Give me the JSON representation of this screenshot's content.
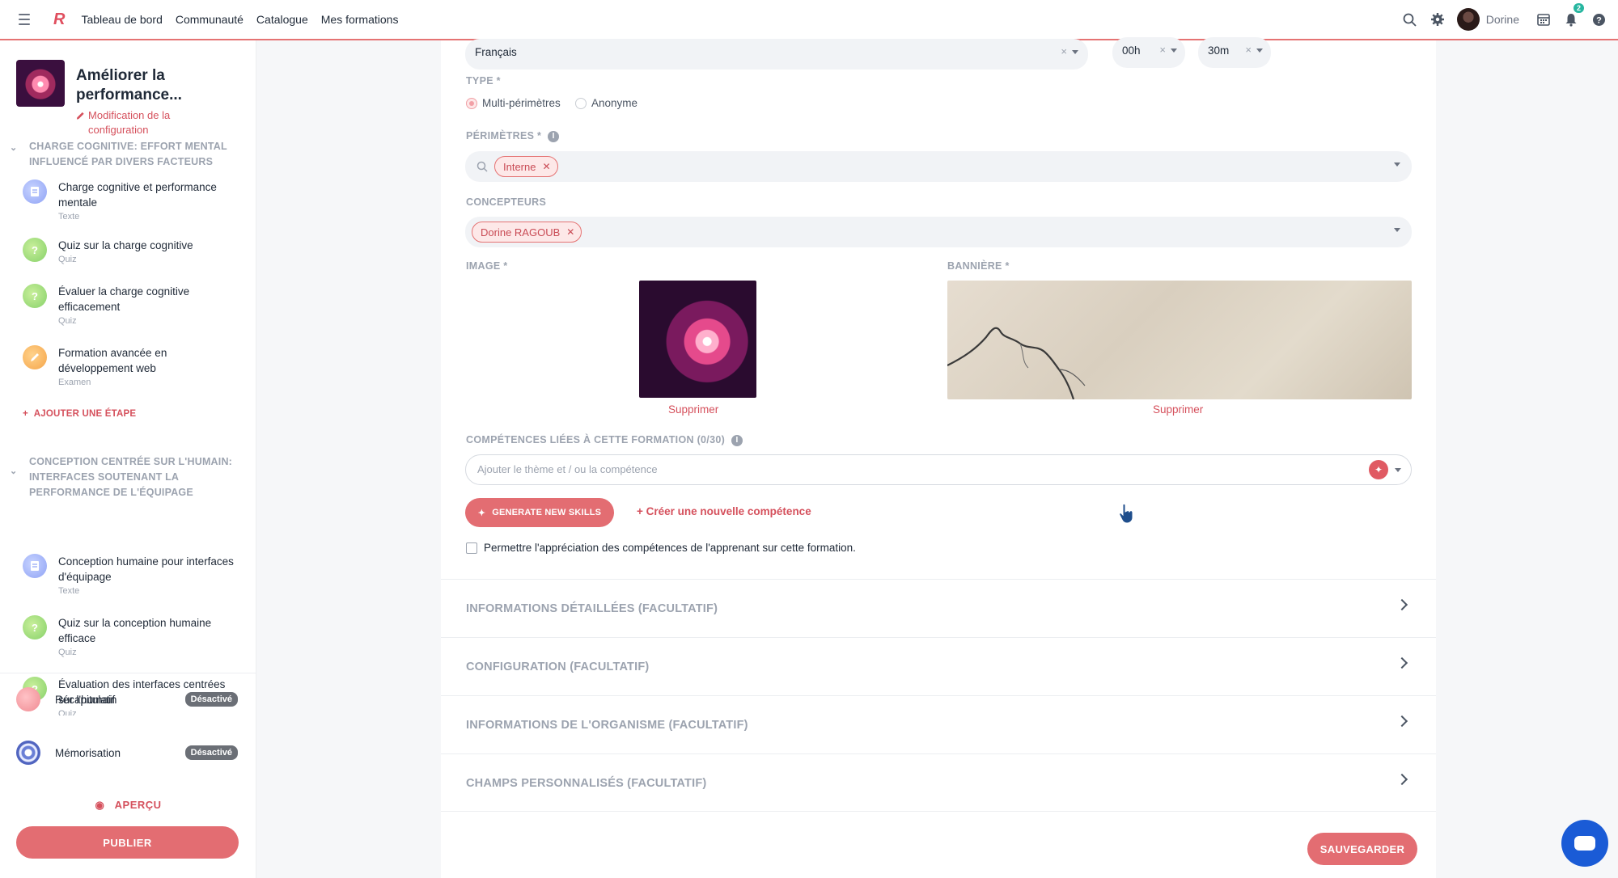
{
  "topbar": {
    "nav": [
      "Tableau de bord",
      "Communauté",
      "Catalogue",
      "Mes formations"
    ],
    "user": "Dorine",
    "notif_count": "2",
    "icons": [
      "menu-icon",
      "search-icon",
      "gear-icon",
      "calendar-icon",
      "bell-icon",
      "help-icon"
    ]
  },
  "sidebar": {
    "course_title": "Améliorer la performance...",
    "edit_label": "Modification de la configuration",
    "sections": [
      {
        "title": "CHARGE COGNITIVE: EFFORT MENTAL INFLUENCÉ PAR DIVERS FACTEURS",
        "steps": [
          {
            "title": "Charge cognitive et performance mentale",
            "type": "Texte"
          },
          {
            "title": "Quiz sur la charge cognitive",
            "type": "Quiz"
          },
          {
            "title": "Évaluer la charge cognitive efficacement",
            "type": "Quiz"
          },
          {
            "title": "Formation avancée en développement web",
            "type": "Examen"
          }
        ],
        "add_step": "AJOUTER UNE ÉTAPE"
      },
      {
        "title": "CONCEPTION CENTRÉE SUR L'HUMAIN: INTERFACES SOUTENANT LA PERFORMANCE DE L'ÉQUIPAGE",
        "steps": [
          {
            "title": "Conception humaine pour interfaces d'équipage",
            "type": "Texte"
          },
          {
            "title": "Quiz sur la conception humaine efficace",
            "type": "Quiz"
          },
          {
            "title": "Évaluation des interfaces centrées sur l'humain",
            "type": "Quiz"
          }
        ]
      }
    ],
    "features": [
      {
        "label": "Récapitulatif",
        "badge": "Désactivé"
      },
      {
        "label": "Mémorisation",
        "badge": "Désactivé"
      }
    ],
    "preview": "APERÇU",
    "publish": "PUBLIER"
  },
  "form": {
    "language": {
      "value": "Français"
    },
    "duration": {
      "hours": "00h",
      "minutes": "30m"
    },
    "type": {
      "label": "TYPE *",
      "options": [
        "Multi-périmètres",
        "Anonyme"
      ],
      "selected": "Multi-périmètres"
    },
    "perimeters": {
      "label": "PÉRIMÈTRES *",
      "chips": [
        "Interne"
      ]
    },
    "designers": {
      "label": "CONCEPTEURS",
      "chips": [
        "Dorine RAGOUB"
      ]
    },
    "image": {
      "label": "IMAGE *",
      "delete": "Supprimer"
    },
    "banner": {
      "label": "BANNIÈRE *",
      "delete": "Supprimer"
    },
    "skills": {
      "label": "COMPÉTENCES LIÉES À CETTE FORMATION (0/30)",
      "placeholder": "Ajouter le thème et / ou la compétence",
      "generate": "GENERATE NEW SKILLS",
      "create": "+ Créer une nouvelle compétence",
      "allow_rating": "Permettre l'appréciation des compétences de l'apprenant sur cette formation."
    },
    "accordions": [
      "INFORMATIONS DÉTAILLÉES (FACULTATIF)",
      "CONFIGURATION (FACULTATIF)",
      "INFORMATIONS DE L'ORGANISME (FACULTATIF)",
      "CHAMPS PERSONNALISÉS (FACULTATIF)"
    ],
    "save": "SAUVEGARDER"
  },
  "colors": {
    "accent": "#e36d72",
    "accent_text": "#d5505c",
    "chat": "#1a5bd6",
    "badge": "#27b6a0"
  }
}
